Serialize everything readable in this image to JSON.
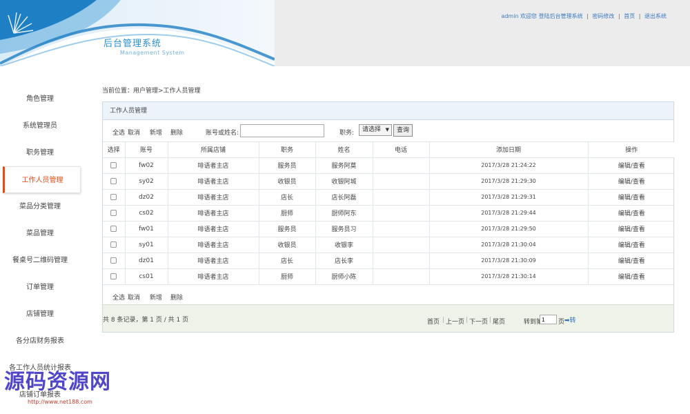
{
  "header": {
    "brand_title": "后台管理系统",
    "brand_subtitle": "Management System",
    "welcome": "admin 欢迎您 登陆后台管理系统",
    "links": [
      "密码修改",
      "首页",
      "退出系统"
    ],
    "separator": "|"
  },
  "sidebar": {
    "items": [
      {
        "label": "角色管理"
      },
      {
        "label": "系统管理员"
      },
      {
        "label": "职务管理"
      },
      {
        "label": "工作人员管理",
        "active": true
      },
      {
        "label": "菜品分类管理"
      },
      {
        "label": "菜品管理"
      },
      {
        "label": "餐桌号二维码管理"
      },
      {
        "label": "订单管理"
      },
      {
        "label": "店铺管理"
      },
      {
        "label": "各分店财务报表"
      },
      {
        "label": "各工作人员统计报表"
      },
      {
        "label": "店铺订单报表"
      }
    ]
  },
  "breadcrumb": "当前位置：用户管理>工作人员管理",
  "panel": {
    "title": "工作人员管理",
    "toolbar": {
      "select_all": "全选",
      "cancel": "取消",
      "add": "新增",
      "delete": "删除",
      "search_label": "账号或姓名:",
      "search_value": "",
      "role_label": "职务:",
      "role_select": "请选择",
      "query_button": "查询"
    },
    "table": {
      "columns": [
        "选择",
        "账号",
        "所属店铺",
        "职务",
        "姓名",
        "电话",
        "添加日期",
        "操作"
      ],
      "rows": [
        {
          "account": "fw02",
          "store": "啡语者主店",
          "role": "服务员",
          "name": "服务阿莫",
          "phone": "",
          "date": "2017/3/28 21:24:22",
          "ops": "编辑/查看"
        },
        {
          "account": "sy02",
          "store": "啡语者主店",
          "role": "收银员",
          "name": "收银阿城",
          "phone": "",
          "date": "2017/3/28 21:29:30",
          "ops": "编辑/查看"
        },
        {
          "account": "dz02",
          "store": "啡语者主店",
          "role": "店长",
          "name": "店长阿磊",
          "phone": "",
          "date": "2017/3/28 21:29:31",
          "ops": "编辑/查看"
        },
        {
          "account": "cs02",
          "store": "啡语者主店",
          "role": "厨师",
          "name": "厨师阿东",
          "phone": "",
          "date": "2017/3/28 21:29:44",
          "ops": "编辑/查看"
        },
        {
          "account": "fw01",
          "store": "啡语者主店",
          "role": "服务员",
          "name": "服务员习",
          "phone": "",
          "date": "2017/3/28 21:29:50",
          "ops": "编辑/查看"
        },
        {
          "account": "sy01",
          "store": "啡语者主店",
          "role": "收银员",
          "name": "收银李",
          "phone": "",
          "date": "2017/3/28 21:30:04",
          "ops": "编辑/查看"
        },
        {
          "account": "dz01",
          "store": "啡语者主店",
          "role": "店长",
          "name": "店长李",
          "phone": "",
          "date": "2017/3/28 21:30:09",
          "ops": "编辑/查看"
        },
        {
          "account": "cs01",
          "store": "啡语者主店",
          "role": "厨师",
          "name": "厨师小陈",
          "phone": "",
          "date": "2017/3/28 21:30:14",
          "ops": "编辑/查看"
        }
      ]
    },
    "bottom_actions": {
      "select_all": "全选",
      "cancel": "取消",
      "add": "新增",
      "delete": "删除"
    },
    "pager": {
      "summary": "共 8 条记录，第 1 页 / 共 1 页",
      "first": "首页",
      "prev": "上一页",
      "next": "下一页",
      "last": "尾页",
      "jump_label": "转到第",
      "jump_value": "1",
      "jump_unit": "页",
      "go": "➡转"
    }
  },
  "watermark": {
    "text": "源码资源网",
    "url": "http://www.net188.com"
  }
}
